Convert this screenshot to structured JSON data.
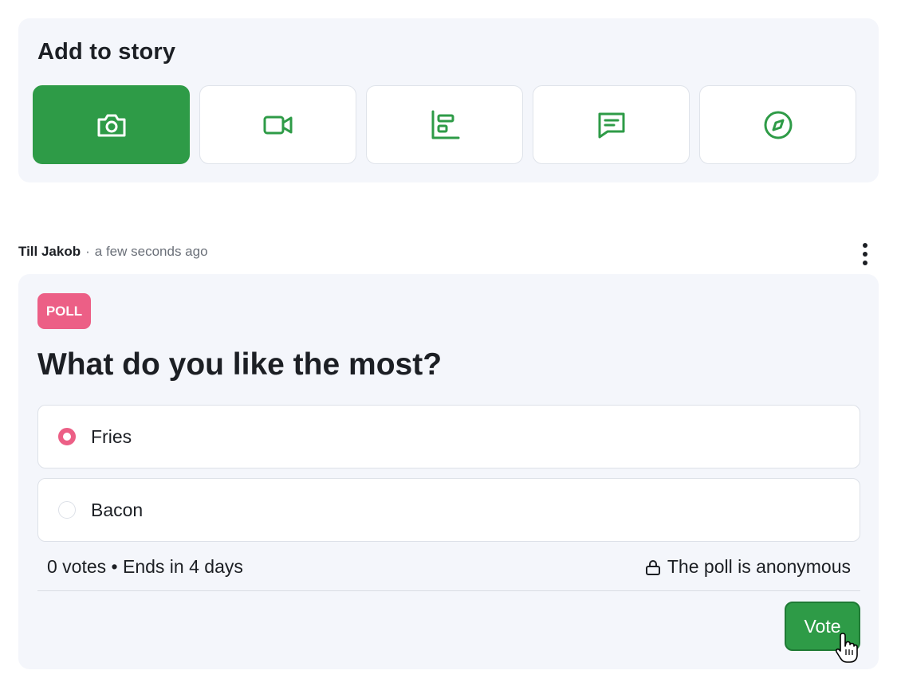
{
  "story": {
    "title": "Add to story",
    "options": [
      {
        "icon": "camera-icon",
        "active": true
      },
      {
        "icon": "video-icon",
        "active": false
      },
      {
        "icon": "bar-chart-icon",
        "active": false
      },
      {
        "icon": "message-icon",
        "active": false
      },
      {
        "icon": "compass-icon",
        "active": false
      }
    ]
  },
  "post": {
    "author": "Till Jakob",
    "separator": "·",
    "time": "a few seconds ago"
  },
  "poll": {
    "badge": "POLL",
    "question": "What do you like the most?",
    "options": [
      {
        "label": "Fries",
        "selected": true
      },
      {
        "label": "Bacon",
        "selected": false
      }
    ],
    "summary": "0 votes • Ends in 4 days",
    "anonymous_text": "The poll is anonymous",
    "vote_label": "Vote"
  },
  "colors": {
    "accent_green": "#2e9b47",
    "poll_pink": "#ec5f86",
    "card_bg": "#f4f6fb"
  }
}
